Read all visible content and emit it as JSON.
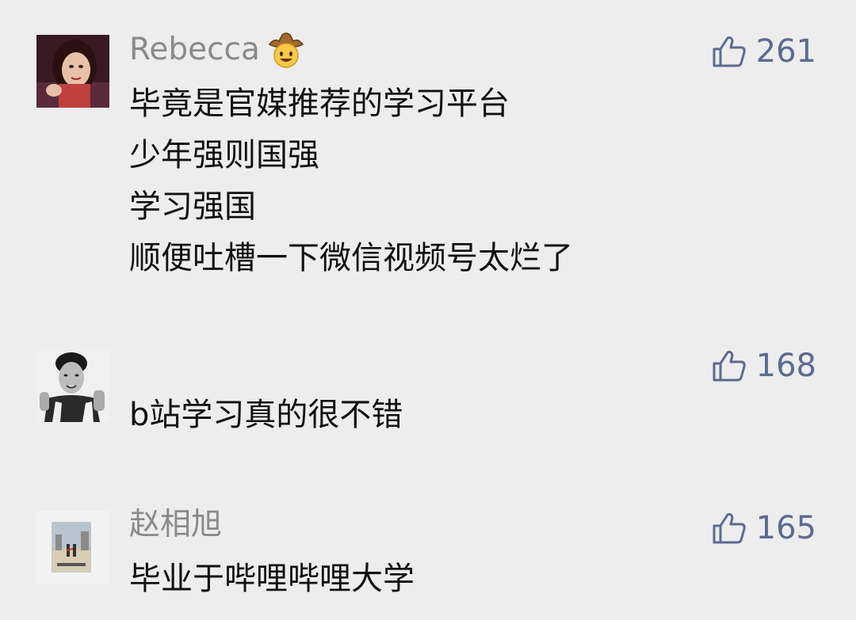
{
  "comments": [
    {
      "username": "Rebecca",
      "badge": "cowboy-emoji",
      "likes": "261",
      "lines": [
        "毕竟是官媒推荐的学习平台",
        "少年强则国强",
        "学习强国",
        "顺便吐槽一下微信视频号太烂了"
      ]
    },
    {
      "username": "",
      "likes": "168",
      "lines": [
        "b站学习真的很不错"
      ]
    },
    {
      "username": "赵相旭",
      "likes": "165",
      "lines": [
        "毕业于哔哩哔哩大学"
      ]
    }
  ],
  "colors": {
    "background": "#ededed",
    "username": "#8a8a8a",
    "likes": "#5b6b92",
    "text": "#111111"
  },
  "icons": [
    "thumbs-up-icon",
    "cowboy-emoji"
  ]
}
